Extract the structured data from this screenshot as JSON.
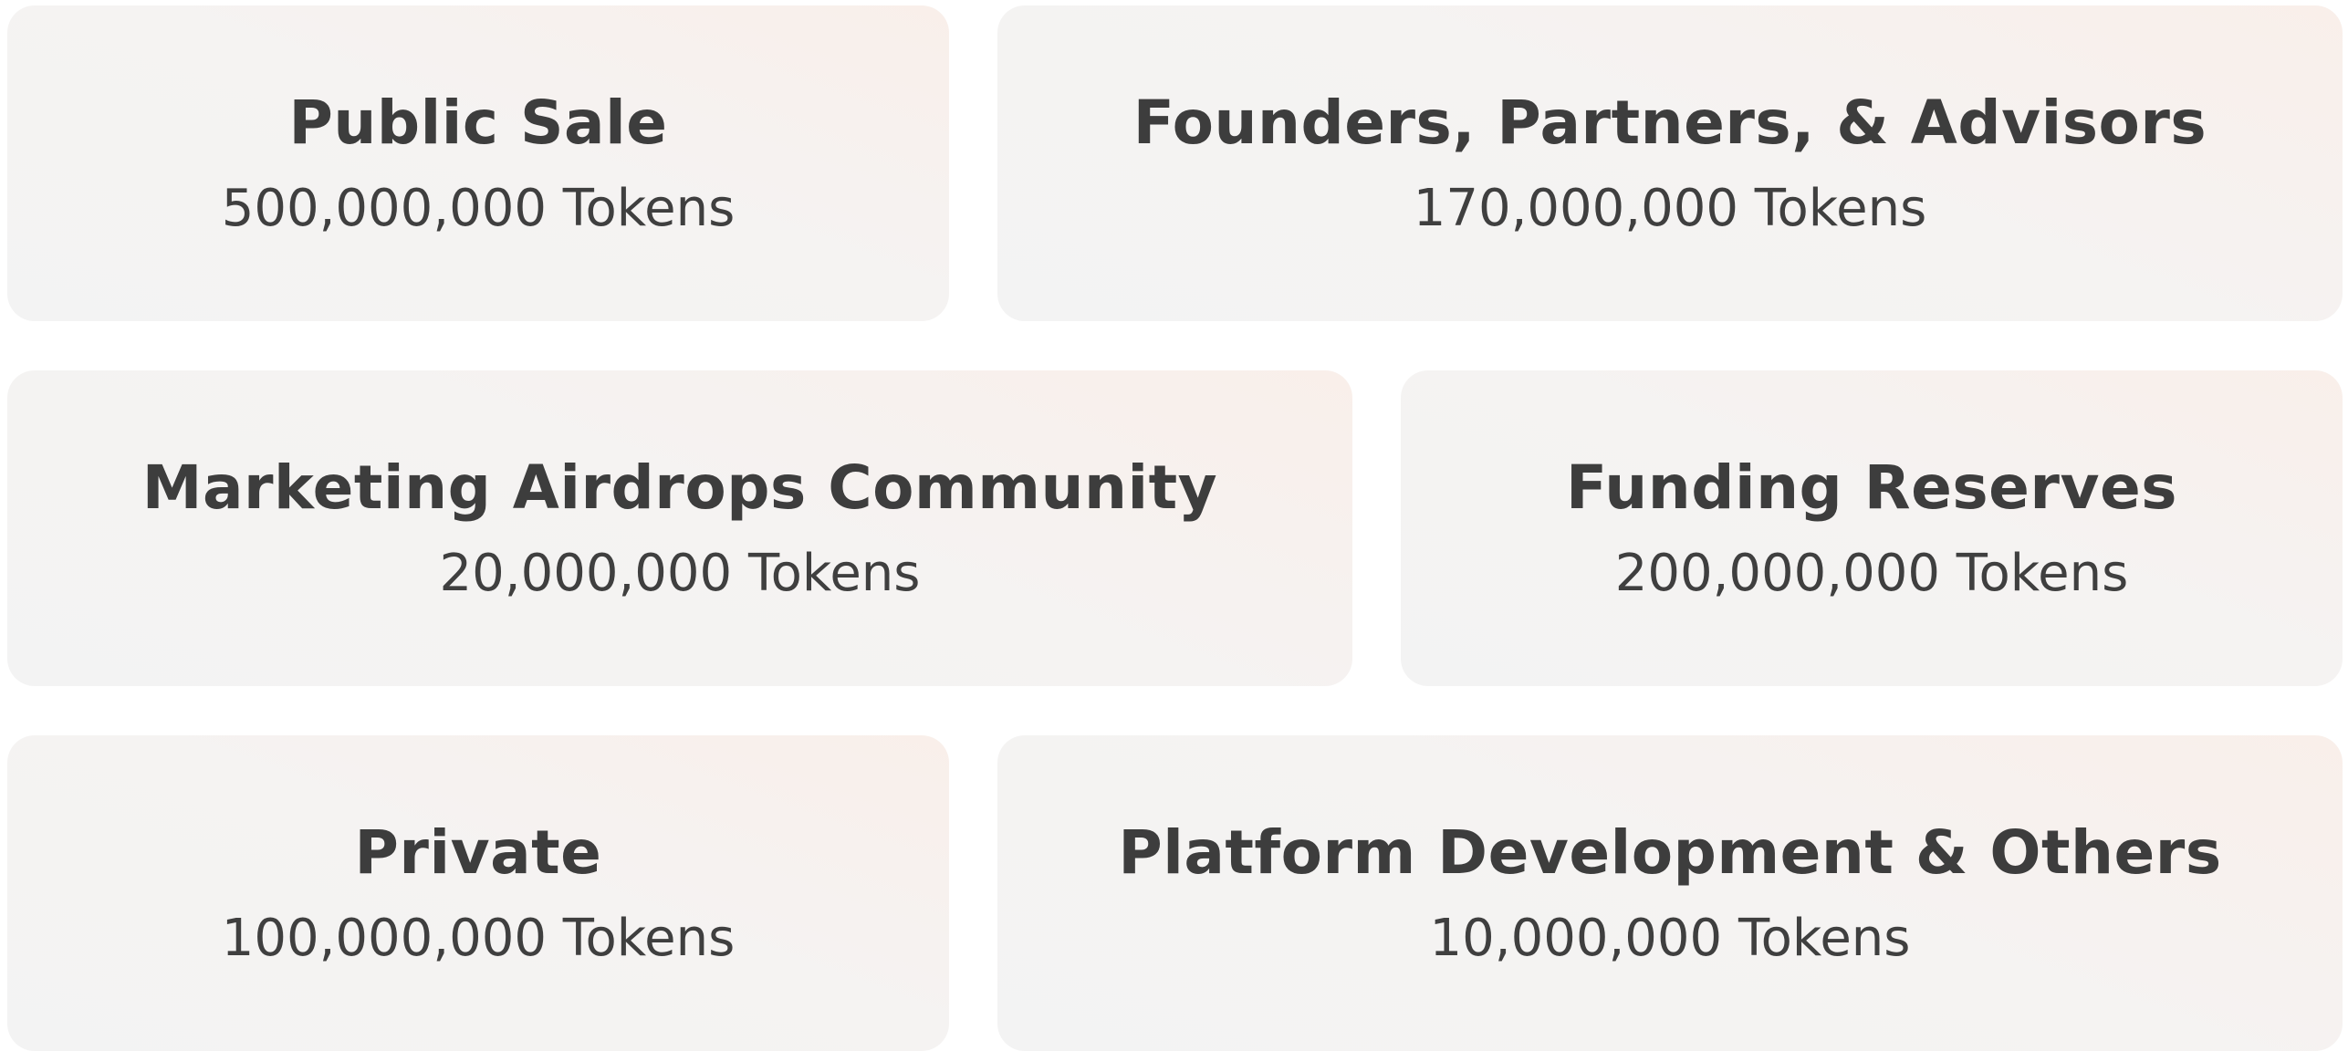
{
  "allocations": [
    {
      "title": "Public Sale",
      "amount": "500,000,000 Tokens"
    },
    {
      "title": "Founders, Partners, & Advisors",
      "amount": "170,000,000 Tokens"
    },
    {
      "title": "Marketing Airdrops Community",
      "amount": "20,000,000 Tokens"
    },
    {
      "title": "Funding Reserves",
      "amount": "200,000,000 Tokens"
    },
    {
      "title": "Private",
      "amount": "100,000,000 Tokens"
    },
    {
      "title": "Platform Development & Others",
      "amount": "10,000,000 Tokens"
    }
  ],
  "colors": {
    "card_background_start": "#f9efea",
    "card_background_end": "#f3f3f3",
    "text": "#3f3f3f"
  }
}
